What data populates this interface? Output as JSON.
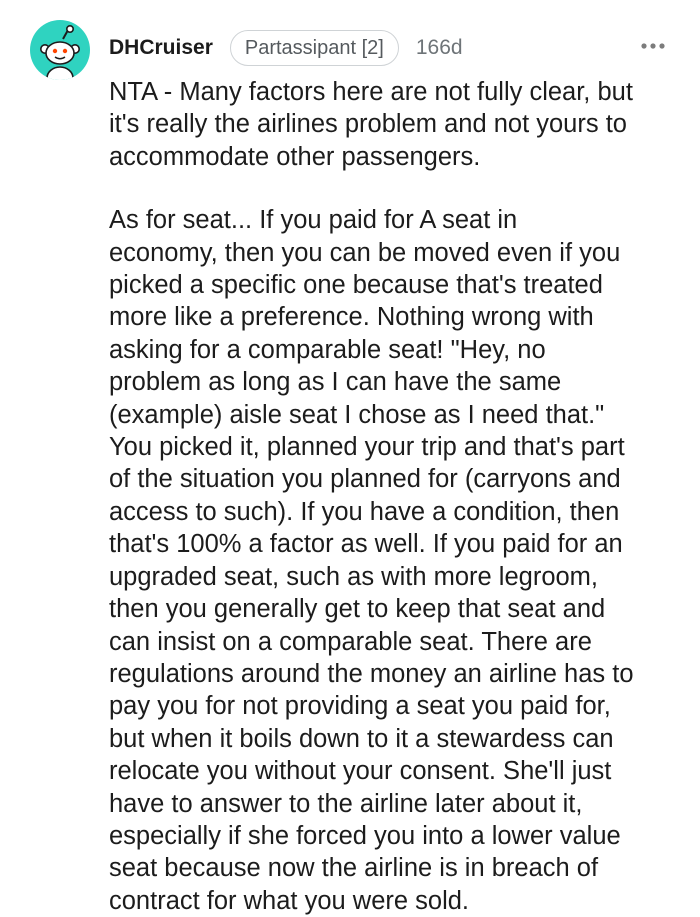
{
  "comment": {
    "author": "DHCruiser",
    "flair": "Partassipant [2]",
    "age": "166d",
    "avatar_icon": "snoo-avatar-icon",
    "avatar_color": "#2fd3c0",
    "more_icon": "more-options-icon",
    "paragraphs": [
      "NTA - Many factors here are not fully clear, but\nit's really the airlines problem and not yours to\naccommodate other passengers.",
      "As for seat... If you paid for A seat in\neconomy, then you can be moved even if you\npicked a specific one because that's treated\nmore like a preference. Nothing wrong with\nasking for a comparable seat! \"Hey, no\nproblem as long as I can have the same\n(example) aisle seat I chose as I need that.\"\nYou picked it, planned your trip and that's part\nof the situation you planned for (carryons and\naccess to such). If you have a condition, then\nthat's 100% a factor as well. If you paid for an\nupgraded seat, such as with more legroom,\nthen you generally get to keep that seat and\ncan insist on a comparable seat. There are\nregulations around the money an airline has to\npay you for not providing a seat you paid for,\nbut when it boils down to it a stewardess can\nrelocate you without your consent. She'll just\nhave to answer to the airline later about it,\nespecially if she forced you into a lower value\nseat because now the airline is in breach of\ncontract for what you were sold."
    ]
  }
}
